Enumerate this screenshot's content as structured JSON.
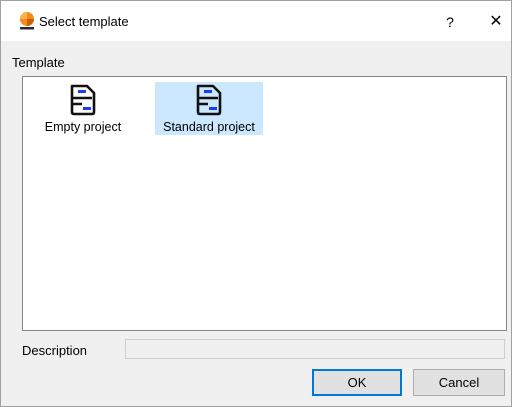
{
  "window": {
    "title": "Select template",
    "icon": "orange-sphere-app-icon",
    "help_label": "?",
    "close_label": "✕"
  },
  "template_section": {
    "label": "Template",
    "items": [
      {
        "label": "Empty project",
        "icon": "project-template-icon",
        "selected": false
      },
      {
        "label": "Standard project",
        "icon": "project-template-icon",
        "selected": true
      }
    ]
  },
  "description": {
    "label": "Description",
    "value": ""
  },
  "buttons": {
    "ok_label": "OK",
    "cancel_label": "Cancel"
  },
  "colors": {
    "selection": "#cce8ff",
    "icon_accent": "#1f3aff",
    "default_button_border": "#0078d7"
  }
}
